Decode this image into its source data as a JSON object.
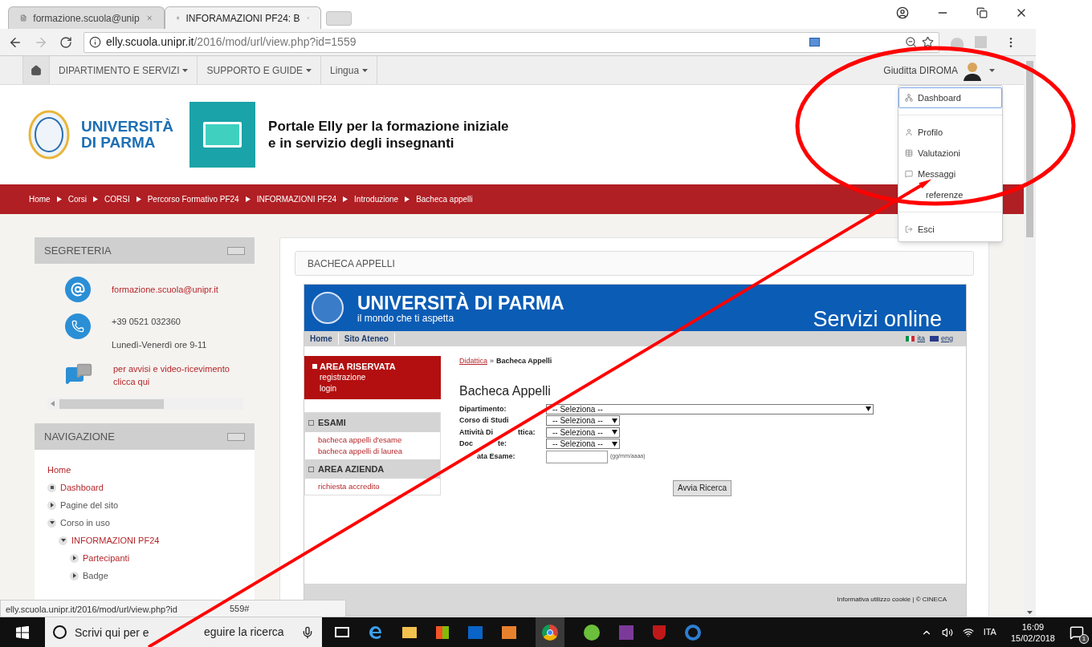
{
  "browser": {
    "tabs": [
      {
        "title": "formazione.scuola@unip",
        "selected": false
      },
      {
        "title": "INFORAMAZIONI PF24: B",
        "selected": true
      }
    ],
    "url_host": "elly.scuola.unipr.it",
    "url_path": "/2016/mod/url/view.php?id=1559"
  },
  "navbar": {
    "items": [
      "DIPARTIMENTO E SERVIZI",
      "SUPPORTO E GUIDE",
      "Lingua"
    ],
    "user": "Giuditta DIROMA"
  },
  "user_menu": {
    "groups": [
      [
        {
          "label": "Dashboard",
          "selected": true
        }
      ],
      [
        {
          "label": "Profilo",
          "selected": false
        },
        {
          "label": "Valutazioni",
          "selected": false
        },
        {
          "label": "Messaggi",
          "selected": false
        },
        {
          "label": "referenze",
          "selected": false
        }
      ],
      [
        {
          "label": "Esci",
          "selected": false
        }
      ]
    ]
  },
  "header": {
    "logo_line1": "UNIVERSITÀ",
    "logo_line2": "DI PARMA",
    "title_line1": "Portale Elly per la formazione iniziale",
    "title_line2": "e in servizio degli insegnanti"
  },
  "breadcrumb": [
    "Home",
    "Corsi",
    "CORSI",
    "Percorso Formativo PF24",
    "INFORMAZIONI PF24",
    "Introduzione",
    "Bacheca appelli"
  ],
  "segreteria": {
    "title": "SEGRETERIA",
    "email": "formazione.scuola@unipr.it",
    "phone": "+39 0521 032360",
    "hours": "Lunedì-Venerdì ore 9-11",
    "chat_line1": "per avvisi e video-ricevimento",
    "chat_line2": "clicca qui"
  },
  "navigazione": {
    "title": "NAVIGAZIONE",
    "items": [
      {
        "label": "Home",
        "kind": "root",
        "link": true
      },
      {
        "label": "Dashboard",
        "kind": "leaf",
        "link": true
      },
      {
        "label": "Pagine del sito",
        "kind": "branch",
        "link": false,
        "expanded": false
      },
      {
        "label": "Corso in uso",
        "kind": "branch",
        "link": false,
        "expanded": true,
        "children": [
          {
            "label": "INFORMAZIONI PF24",
            "kind": "branch",
            "link": true,
            "expanded": true,
            "children": [
              {
                "label": "Partecipanti",
                "kind": "branch",
                "link": true,
                "expanded": false
              },
              {
                "label": "Badge",
                "kind": "branch",
                "link": false,
                "expanded": false
              }
            ]
          }
        ]
      }
    ]
  },
  "main": {
    "title": "BACHECA APPELLI"
  },
  "embedded": {
    "banner_title": "UNIVERSITÀ DI PARMA",
    "banner_subtitle": "il mondo che ti aspetta",
    "banner_right": "Servizi online",
    "nav": [
      "Home",
      "Sito Ateneo"
    ],
    "languages": [
      "ita",
      "eng"
    ],
    "area_riservata": {
      "title": "AREA RISERVATA",
      "links": [
        "registrazione",
        "login"
      ]
    },
    "sections": [
      {
        "title": "ESAMI",
        "links": [
          "bacheca appelli d'esame",
          "bacheca appelli di laurea"
        ]
      },
      {
        "title": "AREA AZIENDA",
        "links": [
          "richiesta accredito"
        ]
      }
    ],
    "crumb_link": "Didattica",
    "crumb_sep": "»",
    "crumb_current": "Bacheca Appelli",
    "heading": "Bacheca Appelli",
    "fields": [
      {
        "label": "Dipartimento:",
        "kind": "wide-select",
        "value": "-- Seleziona --"
      },
      {
        "label": "Corso di Studi",
        "kind": "select",
        "value": "-- Seleziona --"
      },
      {
        "label": "Attività Di",
        "label_after": "ttica:",
        "kind": "select",
        "value": "-- Seleziona --"
      },
      {
        "label": "Doc",
        "label_after": "te:",
        "kind": "select",
        "value": "-- Seleziona --"
      },
      {
        "label_after": "ata Esame:",
        "kind": "date",
        "hint": "(gg/mm/aaaa)"
      }
    ],
    "button": "Avvia Ricerca",
    "footer": "Informativa utilizzo cookie | © CINECA"
  },
  "status_url": "elly.scuola.unipr.it/2016/mod/url/view.php?id",
  "status_url_after": "559#",
  "taskbar": {
    "search_placeholder": "Scrivi qui per e",
    "search_placeholder_after": "eguire la ricerca",
    "language": "ITA",
    "time": "16:09",
    "date": "15/02/2018",
    "notifications": "1"
  }
}
